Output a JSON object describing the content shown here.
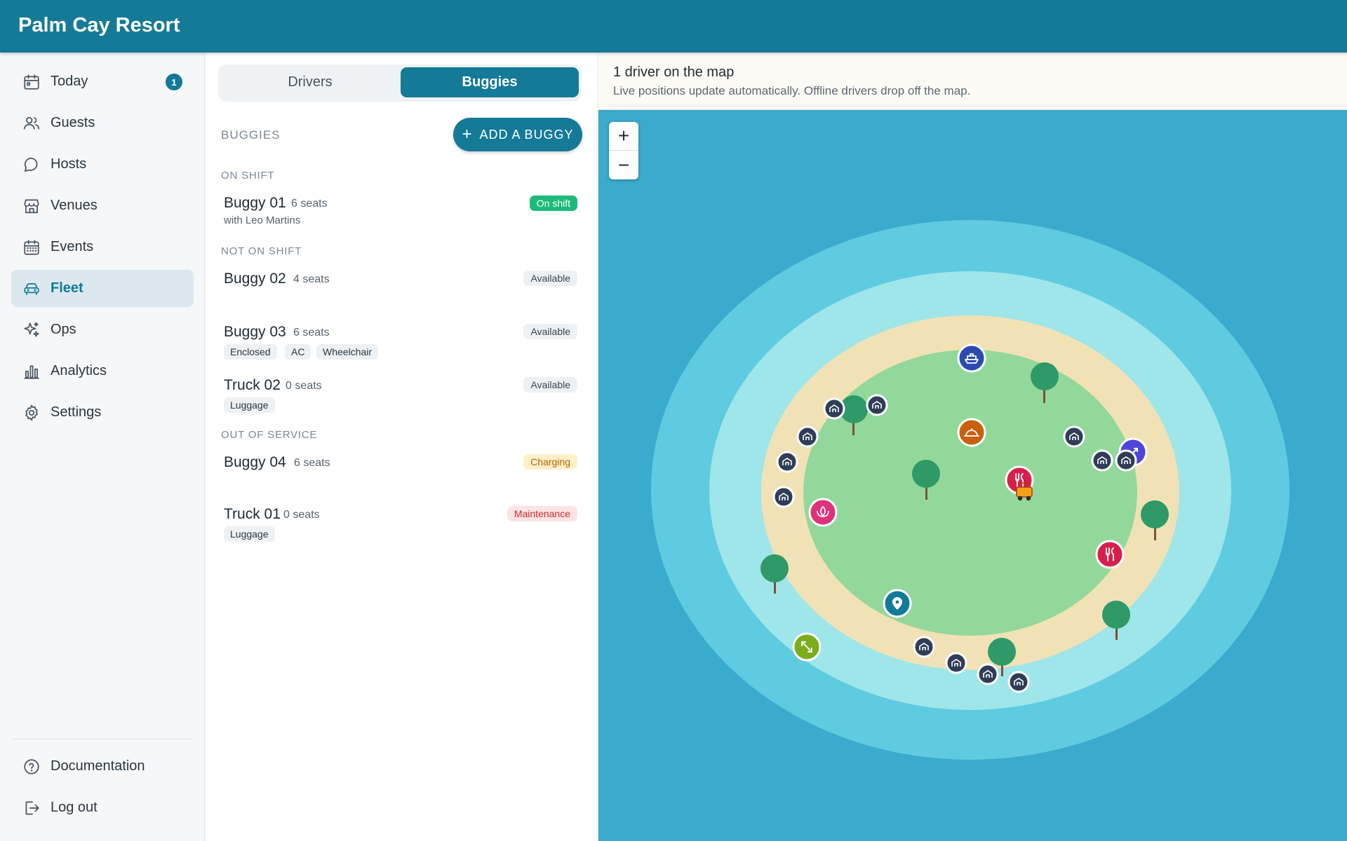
{
  "app": {
    "title": "Palm Cay Resort"
  },
  "sidebar": {
    "items": [
      {
        "label": "Today",
        "icon": "calendar-icon",
        "badge": "1"
      },
      {
        "label": "Guests",
        "icon": "users-icon"
      },
      {
        "label": "Hosts",
        "icon": "chat-icon"
      },
      {
        "label": "Venues",
        "icon": "store-icon"
      },
      {
        "label": "Events",
        "icon": "calendar-grid-icon"
      },
      {
        "label": "Fleet",
        "icon": "car-icon",
        "active": true
      },
      {
        "label": "Ops",
        "icon": "sparkle-icon"
      },
      {
        "label": "Analytics",
        "icon": "bar-chart-icon"
      },
      {
        "label": "Settings",
        "icon": "gear-icon"
      }
    ],
    "footer": [
      {
        "label": "Documentation",
        "icon": "help-icon"
      },
      {
        "label": "Log out",
        "icon": "logout-icon"
      }
    ]
  },
  "fleet": {
    "tabs": [
      {
        "label": "Drivers",
        "active": false
      },
      {
        "label": "Buggies",
        "active": true
      }
    ],
    "section_title": "BUGGIES",
    "add_button": "ADD A BUGGY",
    "groups": {
      "on_shift": "ON SHIFT",
      "not_on_shift": "NOT ON SHIFT",
      "out_of_service": "OUT OF SERVICE"
    },
    "buggies": [
      {
        "name": "Buggy 01",
        "seats": "6 seats",
        "driver": "with Leo Martins",
        "status": "On shift"
      },
      {
        "name": "Buggy 02",
        "seats": "4 seats",
        "status": "Available"
      },
      {
        "name": "Buggy 03",
        "seats": "6 seats",
        "features": [
          "Enclosed",
          "AC",
          "Wheelchair"
        ],
        "status": "Available"
      },
      {
        "name": "Truck 02",
        "seats": "0 seats",
        "features": [
          "Luggage"
        ],
        "status": "Available"
      },
      {
        "name": "Buggy 04",
        "seats": "6 seats",
        "status": "Charging"
      },
      {
        "name": "Truck 01",
        "seats": "0 seats",
        "features": [
          "Luggage"
        ],
        "status": "Maintenance"
      }
    ]
  },
  "map": {
    "headline": "1 driver on the map",
    "subtitle": "Live positions update automatically. Offline drivers drop off the map.",
    "zoom_in": "+",
    "zoom_out": "−",
    "colors": {
      "deep_water": "#3aabcc",
      "mid_water": "#5fcbe0",
      "shallow_water": "#9ee6ea",
      "sand": "#f1e2b6",
      "grass": "#93d89b",
      "tree": "#2f9a68",
      "villa_marker": "#2f3d56",
      "restaurant_marker": "#d81f4c",
      "spa_marker": "#e0327b",
      "ferry_marker": "#2b4bb0",
      "room_service_marker": "#c9600d",
      "sport_marker": "#7cad1a",
      "location_marker": "#147a98",
      "buggy": "#f2a21a"
    }
  }
}
